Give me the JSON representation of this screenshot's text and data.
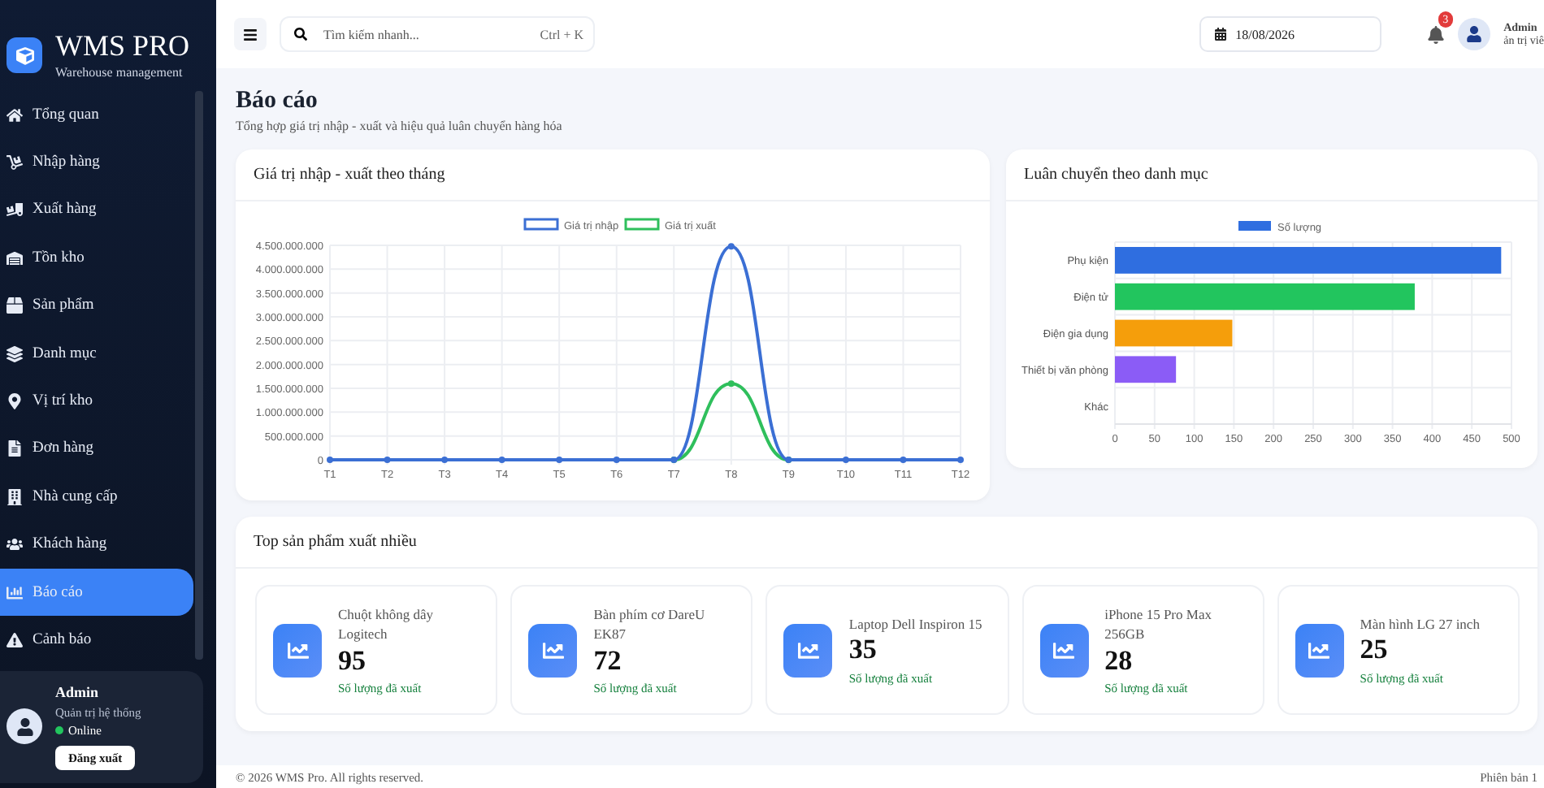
{
  "brand": {
    "title": "WMS PRO",
    "subtitle": "Warehouse management"
  },
  "sidebar": {
    "items": [
      {
        "label": "Tổng quan",
        "selected": false
      },
      {
        "label": "Nhập hàng",
        "selected": false
      },
      {
        "label": "Xuất hàng",
        "selected": false
      },
      {
        "label": "Tồn kho",
        "selected": false
      },
      {
        "label": "Sản phẩm",
        "selected": false
      },
      {
        "label": "Danh mục",
        "selected": false
      },
      {
        "label": "Vị trí kho",
        "selected": false
      },
      {
        "label": "Đơn hàng",
        "selected": false
      },
      {
        "label": "Nhà cung cấp",
        "selected": false
      },
      {
        "label": "Khách hàng",
        "selected": false
      },
      {
        "label": "Báo cáo",
        "selected": true
      },
      {
        "label": "Cảnh báo",
        "selected": false
      }
    ],
    "user": {
      "name": "Admin",
      "role": "Quản trị hệ thống",
      "status": "Online",
      "online": true,
      "logout": "Đăng xuất"
    }
  },
  "header": {
    "search": {
      "placeholder": "Tìm kiếm nhanh...",
      "shortcut": "Ctrl + K"
    },
    "date": "18/08/2026",
    "notifications": "3",
    "user": {
      "name": "Admin",
      "role": "ản trị viê"
    }
  },
  "page": {
    "title": "Báo cáo",
    "subtitle": "Tổng hợp giá trị nhập - xuất và hiệu quả luân chuyển hàng hóa"
  },
  "monthly_card": {
    "title": "Giá trị nhập - xuất theo tháng",
    "chart_data": {
      "type": "line",
      "categories": [
        "T1",
        "T2",
        "T3",
        "T4",
        "T5",
        "T6",
        "T7",
        "T8",
        "T9",
        "T10",
        "T11",
        "T12"
      ],
      "grid": true,
      "legend": "top",
      "series": [
        {
          "name": "Giá trị nhập",
          "color": "#3b6fd4",
          "marker": "circle",
          "values": [
            0,
            0,
            0,
            0,
            0,
            0,
            0,
            4480000000,
            0,
            0,
            0,
            0
          ]
        },
        {
          "name": "Giá trị xuất",
          "color": "#2fbf5c",
          "marker": "circle",
          "values": [
            null,
            null,
            null,
            null,
            null,
            null,
            0,
            1600000000,
            0,
            null,
            null,
            null
          ]
        }
      ],
      "ylim": [
        0,
        4500000000
      ],
      "yticks": [
        {
          "value": 0,
          "label": "0"
        },
        {
          "value": 500000000,
          "label": "500.000.000"
        },
        {
          "value": 1000000000,
          "label": "1.000.000.000"
        },
        {
          "value": 1500000000,
          "label": "1.500.000.000"
        },
        {
          "value": 2000000000,
          "label": "2.000.000.000"
        },
        {
          "value": 2500000000,
          "label": "2.500.000.000"
        },
        {
          "value": 3000000000,
          "label": "3.000.000.000"
        },
        {
          "value": 3500000000,
          "label": "3.500.000.000"
        },
        {
          "value": 4000000000,
          "label": "4.000.000.000"
        },
        {
          "value": 4500000000,
          "label": "4.500.000.000"
        }
      ]
    }
  },
  "category_card": {
    "title": "Luân chuyển theo danh mục",
    "chart_data": {
      "type": "bar",
      "orientation": "horizontal",
      "categories": [
        "Phụ kiện",
        "Điện tử",
        "Điện gia dụng",
        "Thiết bị văn phòng",
        "Khác"
      ],
      "grid": true,
      "legend": "top",
      "series": [
        {
          "name": "Số lượng",
          "colors": [
            "#2f6ee0",
            "#22c55e",
            "#f59e0b",
            "#8b5cf6",
            null
          ],
          "values": [
            487,
            378,
            148,
            77,
            null
          ]
        }
      ],
      "xlim": [
        0,
        500
      ],
      "xticks": [
        0,
        50,
        100,
        150,
        200,
        250,
        300,
        350,
        400,
        450,
        500
      ]
    }
  },
  "top_products": {
    "title": "Top sản phẩm xuất nhiều",
    "items": [
      {
        "name": "Chuột không dây Logitech",
        "count": "95",
        "caption": "Số lượng đã xuất"
      },
      {
        "name": "Bàn phím cơ DareU EK87",
        "count": "72",
        "caption": "Số lượng đã xuất"
      },
      {
        "name": "Laptop Dell Inspiron 15",
        "count": "35",
        "caption": "Số lượng đã xuất"
      },
      {
        "name": "iPhone 15 Pro Max 256GB",
        "count": "28",
        "caption": "Số lượng đã xuất"
      },
      {
        "name": "Màn hình LG 27 inch",
        "count": "25",
        "caption": "Số lượng đã xuất"
      }
    ]
  },
  "footer": {
    "copyright": "© 2026 WMS Pro. All rights reserved.",
    "version": "Phiên bản 1"
  }
}
